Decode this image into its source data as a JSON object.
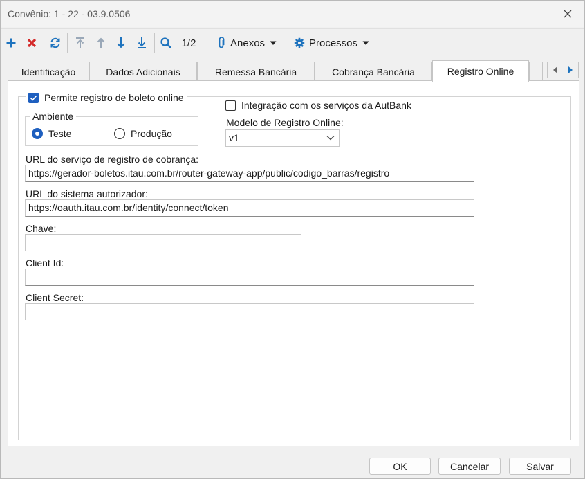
{
  "window": {
    "title": "Convênio: 1 - 22 - 03.9.0506"
  },
  "toolbar": {
    "record_position": "1/2",
    "anexos_label": "Anexos",
    "processos_label": "Processos",
    "colors": {
      "add": "#1e73be",
      "delete": "#d42a2a",
      "nav": "#1e73be",
      "nav_disabled": "#9aa8b8"
    }
  },
  "tabs": [
    {
      "label": "Identificação"
    },
    {
      "label": "Dados Adicionais"
    },
    {
      "label": "Remessa Bancária"
    },
    {
      "label": "Cobrança Bancária"
    },
    {
      "label": "Registro Online",
      "active": true
    }
  ],
  "form": {
    "permite_registro": {
      "label": "Permite registro de boleto online",
      "checked": true
    },
    "integracao": {
      "label": "Integração com os serviços da AutBank",
      "checked": false
    },
    "ambiente": {
      "legend": "Ambiente",
      "options": [
        {
          "label": "Teste",
          "selected": true
        },
        {
          "label": "Produção",
          "selected": false
        }
      ]
    },
    "modelo": {
      "label": "Modelo de Registro Online:",
      "value": "v1"
    },
    "url_servico": {
      "label": "URL do serviço de registro de cobrança:",
      "value": "https://gerador-boletos.itau.com.br/router-gateway-app/public/codigo_barras/registro"
    },
    "url_autorizador": {
      "label": "URL do sistema autorizador:",
      "value": "https://oauth.itau.com.br/identity/connect/token"
    },
    "chave": {
      "label": "Chave:",
      "value": ""
    },
    "client_id": {
      "label": "Client Id:",
      "value": ""
    },
    "client_secret": {
      "label": "Client Secret:",
      "value": ""
    }
  },
  "footer": {
    "ok_label": "OK",
    "cancel_label": "Cancelar",
    "save_label": "Salvar"
  },
  "colors": {
    "accent": "#1e5fbf"
  }
}
